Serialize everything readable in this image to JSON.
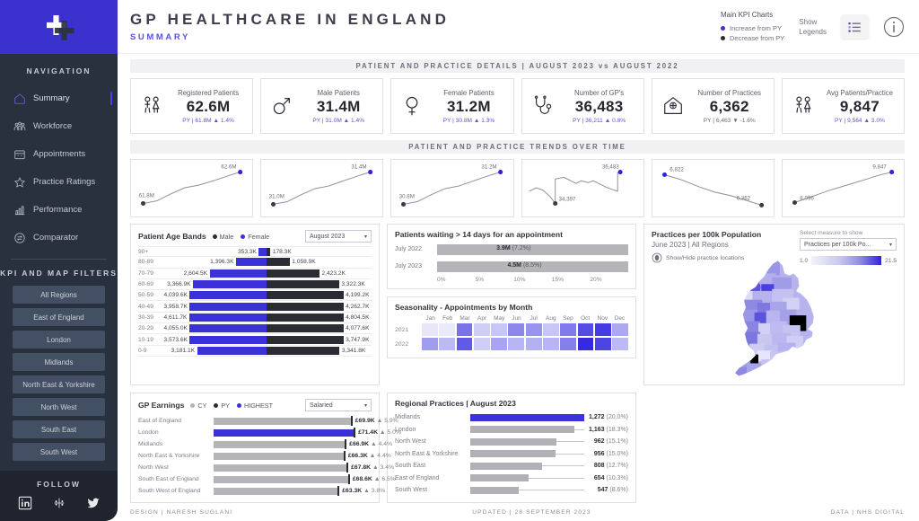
{
  "sidebar": {
    "logo_name": "nhs-cross-logo",
    "nav_heading": "NAVIGATION",
    "nav_items": [
      {
        "label": "Summary",
        "icon": "home-icon",
        "active": true
      },
      {
        "label": "Workforce",
        "icon": "people-icon",
        "active": false
      },
      {
        "label": "Appointments",
        "icon": "calendar-icon",
        "active": false
      },
      {
        "label": "Practice Ratings",
        "icon": "star-icon",
        "active": false
      },
      {
        "label": "Performance",
        "icon": "bar-chart-icon",
        "active": false
      },
      {
        "label": "Comparator",
        "icon": "compare-icon",
        "active": false
      }
    ],
    "filters_heading": "KPI AND MAP FILTERS",
    "filters": [
      {
        "label": "All Regions"
      },
      {
        "label": "East of England"
      },
      {
        "label": "London"
      },
      {
        "label": "Midlands"
      },
      {
        "label": "North East & Yorkshire"
      },
      {
        "label": "North West"
      },
      {
        "label": "South East"
      },
      {
        "label": "South West"
      }
    ],
    "follow_heading": "FOLLOW",
    "social": [
      {
        "name": "linkedin-icon"
      },
      {
        "name": "tableau-icon"
      },
      {
        "name": "twitter-icon"
      }
    ]
  },
  "header": {
    "title": "GP HEALTHCARE IN ENGLAND",
    "subtitle": "SUMMARY",
    "kpi_legend_title": "Main KPI Charts",
    "legend_increase": "Increase from PY",
    "legend_decrease": "Decrease from PY",
    "legend_increase_color": "#3a31d8",
    "legend_decrease_color": "#2b2b33",
    "show_legends_line1": "Show",
    "show_legends_line2": "Legends",
    "legend_button_icon": "list-legend-icon",
    "info_icon": "info-icon"
  },
  "bands": {
    "kpi": "PATIENT AND PRACTICE DETAILS | AUGUST 2023 vs AUGUST 2022",
    "trends": "PATIENT AND PRACTICE TRENDS OVER TIME"
  },
  "kpi_cards": [
    {
      "icon": "male-female-pair-icon",
      "label": "Registered Patients",
      "value": "62.6M",
      "py_prefix": "PY |",
      "py_value": "61.8M",
      "arrow": "▲",
      "delta": "1.4%",
      "up": true
    },
    {
      "icon": "male-symbol-icon",
      "label": "Male Patients",
      "value": "31.4M",
      "py_prefix": "PY |",
      "py_value": "31.0M",
      "arrow": "▲",
      "delta": "1.4%",
      "up": true
    },
    {
      "icon": "female-symbol-icon",
      "label": "Female Patients",
      "value": "31.2M",
      "py_prefix": "PY |",
      "py_value": "30.8M",
      "arrow": "▲",
      "delta": "1.3%",
      "up": true
    },
    {
      "icon": "stethoscope-icon",
      "label": "Number of GP's",
      "value": "36,483",
      "py_prefix": "PY |",
      "py_value": "36,211",
      "arrow": "▲",
      "delta": "0.8%",
      "up": true
    },
    {
      "icon": "clinic-house-icon",
      "label": "Number of Practices",
      "value": "6,362",
      "py_prefix": "PY |",
      "py_value": "6,463",
      "arrow": "▼",
      "delta": "-1.6%",
      "up": false
    },
    {
      "icon": "male-female-pair-icon",
      "label": "Avg Patients/Practice",
      "value": "9,847",
      "py_prefix": "PY |",
      "py_value": "9,564",
      "arrow": "▲",
      "delta": "3.0%",
      "up": true
    }
  ],
  "chart_data": [
    {
      "type": "line",
      "name": "registered-patients-trend",
      "title": "Registered Patients trend",
      "start_label": "61.8M",
      "end_label": "62.6M",
      "values": [
        0.1,
        0.14,
        0.32,
        0.48,
        0.55,
        0.72,
        0.88,
        1.0
      ],
      "grid": false,
      "legend": "none"
    },
    {
      "type": "line",
      "name": "male-patients-trend",
      "title": "Male Patients trend",
      "start_label": "31.0M",
      "end_label": "31.4M",
      "values": [
        0.08,
        0.12,
        0.3,
        0.47,
        0.54,
        0.7,
        0.87,
        1.0
      ],
      "grid": false,
      "legend": "none"
    },
    {
      "type": "line",
      "name": "female-patients-trend",
      "title": "Female Patients trend",
      "start_label": "30.8M",
      "end_label": "31.2M",
      "values": [
        0.08,
        0.13,
        0.31,
        0.48,
        0.55,
        0.71,
        0.88,
        1.0
      ],
      "grid": false,
      "legend": "none"
    },
    {
      "type": "line",
      "name": "number-of-gps-trend",
      "title": "Number of GP's trend",
      "start_label": "34,397",
      "end_label": "36,483",
      "values": [
        0.42,
        0.5,
        0.4,
        0.25,
        0.0,
        0.78,
        0.72,
        0.66,
        0.7,
        0.6,
        0.66,
        0.7,
        0.6,
        0.5,
        0.46,
        1.0
      ],
      "grid": false,
      "legend": "none"
    },
    {
      "type": "line",
      "name": "number-of-practices-trend",
      "title": "Number of Practices trend",
      "start_label": "6,822",
      "end_label": "6,362",
      "values": [
        1.0,
        0.86,
        0.72,
        0.6,
        0.5,
        0.42,
        0.36,
        0.3,
        0.22,
        0.12,
        0.05,
        0.0
      ],
      "grid": false,
      "legend": "none"
    },
    {
      "type": "line",
      "name": "avg-patients-per-practice-trend",
      "title": "Avg Patients/Practice trend",
      "start_label": "8,096",
      "end_label": "9,847",
      "values": [
        0.0,
        0.12,
        0.26,
        0.4,
        0.52,
        0.64,
        0.76,
        0.88,
        1.0
      ],
      "grid": false,
      "legend": "none"
    },
    {
      "type": "bar",
      "name": "patient-age-bands",
      "title": "Patient Age Bands",
      "subtitle": "August 2023",
      "orientation": "horizontal-diverging",
      "categories": [
        "90+",
        "80-89",
        "70-79",
        "60-69",
        "50-59",
        "40-49",
        "30-39",
        "20-29",
        "10-19",
        "0-9"
      ],
      "series": [
        {
          "name": "Female",
          "color": "#3a31d8",
          "side": "left",
          "labels": [
            "353.3K",
            "1,396.3K",
            "2,604.5K",
            "3,366.9K",
            "4,039.6K",
            "3,958.7K",
            "4,611.7K",
            "4,055.0K",
            "3,573.6K",
            "3,181.1K"
          ],
          "values": [
            353.3,
            1396.3,
            2604.5,
            3366.9,
            4039.6,
            3958.7,
            4611.7,
            4055.0,
            3573.6,
            3181.1
          ]
        },
        {
          "name": "Male",
          "color": "#2b2b33",
          "side": "right",
          "labels": [
            "178.3K",
            "1,058.9K",
            "2,423.2K",
            "3,322.3K",
            "4,199.2K",
            "4,262.7K",
            "4,804.5K",
            "4,077.6K",
            "3,747.9K",
            "3,341.8K"
          ],
          "values": [
            178.3,
            1058.9,
            2423.2,
            3322.3,
            4199.2,
            4262.7,
            4804.5,
            4077.6,
            3747.9,
            3341.8
          ]
        }
      ],
      "max_value": 4804.5,
      "xlabel": "",
      "ylabel": "Age band"
    },
    {
      "type": "bar",
      "name": "patients-waiting-over-14-days",
      "title": "Patients waiting  > 14 days for an appointment",
      "orientation": "horizontal",
      "categories": [
        "July 2022",
        "July 2023"
      ],
      "values": [
        7.2,
        8.5
      ],
      "value_labels": [
        "3.9M",
        "4.5M"
      ],
      "pct_labels": [
        "(7.2%)",
        "(8.5%)"
      ],
      "xlim": [
        0,
        22.5
      ],
      "xticks": [
        "0%",
        "5%",
        "10%",
        "15%",
        "20%"
      ],
      "bar_color": "#3a31d8",
      "track_color": "#b4b4b9",
      "grid": false
    },
    {
      "type": "heatmap",
      "name": "seasonality-appointments-by-month",
      "title": "Seasonality - Appointments by Month",
      "x": [
        "Jan",
        "Feb",
        "Mar",
        "Apr",
        "May",
        "Jun",
        "Jul",
        "Aug",
        "Sep",
        "Oct",
        "Nov",
        "Dec"
      ],
      "y": [
        "2021",
        "2022"
      ],
      "values": [
        [
          0.06,
          0.05,
          0.62,
          0.18,
          0.22,
          0.52,
          0.46,
          0.22,
          0.58,
          0.8,
          0.88,
          0.36
        ],
        [
          0.42,
          0.28,
          0.74,
          0.18,
          0.38,
          0.3,
          0.32,
          0.3,
          0.56,
          0.96,
          0.84,
          0.28
        ]
      ],
      "colorscale": [
        "#f4f4fc",
        "#2d22e0"
      ]
    },
    {
      "type": "bar",
      "name": "gp-earnings",
      "title": "GP Earnings",
      "subtitle": "Salaried",
      "orientation": "horizontal",
      "legend": [
        "CY",
        "PY",
        "HIGHEST"
      ],
      "legend_colors": [
        "#b4b4b9",
        "#2b2b33",
        "#3a31d8"
      ],
      "categories": [
        "East of England",
        "London",
        "Midlands",
        "North East & Yorkshire",
        "North West",
        "South East of England",
        "South West of England"
      ],
      "values": [
        69.9,
        71.4,
        66.9,
        66.3,
        67.8,
        68.6,
        63.3
      ],
      "value_labels": [
        "£69.9K",
        "£71.4K",
        "£66.9K",
        "£66.3K",
        "£67.8K",
        "£68.6K",
        "£63.3K"
      ],
      "delta_labels": [
        "5.9%",
        "5.0%",
        "4.4%",
        "4.4%",
        "3.4%",
        "6.5%",
        "3.8%"
      ],
      "arrow": "▲",
      "highest_index": 1
    },
    {
      "type": "bar",
      "name": "regional-practices",
      "title": "Regional Practices | August 2023",
      "orientation": "horizontal",
      "categories": [
        "Midlands",
        "London",
        "North West",
        "North East & Yorkshire",
        "South East",
        "East of England",
        "South West"
      ],
      "values": [
        1272,
        1163,
        962,
        956,
        808,
        654,
        547
      ],
      "value_labels": [
        "1,272",
        "1,163",
        "962",
        "956",
        "808",
        "654",
        "547"
      ],
      "pct_labels": [
        "(20.0%)",
        "(18.3%)",
        "(15.1%)",
        "(15.0%)",
        "(12.7%)",
        "(10.3%)",
        "(8.6%)"
      ],
      "highest_index": 0,
      "bar_color": "#b0b0b6",
      "highlight_color": "#3a31d8"
    },
    {
      "type": "heatmap",
      "name": "practices-per-100k-population-map",
      "title": "Practices per 100k Population",
      "subtitle": "June 2023 | All Regions",
      "legend_min": "1.0",
      "legend_max": "21.5",
      "colorscale": [
        "#f2f2fb",
        "#2d22e0"
      ],
      "geography": "England CCG / ICB areas"
    }
  ],
  "age_panel": {
    "title": "Patient Age Bands",
    "legend": [
      {
        "label": "Male",
        "color": "#2b2b33"
      },
      {
        "label": "Female",
        "color": "#3a31d8"
      }
    ],
    "select_value": "August 2023"
  },
  "waiting_panel": {
    "title": "Patients waiting  > 14 days for an appointment"
  },
  "season_panel": {
    "title": "Seasonality - Appointments by Month"
  },
  "earnings_panel": {
    "title": "GP Earnings",
    "legend": [
      {
        "label": "CY",
        "color": "#b4b4b9"
      },
      {
        "label": "PY",
        "color": "#2b2b33"
      },
      {
        "label": "HIGHEST",
        "color": "#3a31d8"
      }
    ],
    "select_value": "Salaried"
  },
  "regional_panel": {
    "title": "Regional Practices | August 2023"
  },
  "map_panel": {
    "title": "Practices per 100k Population",
    "subtitle": "June 2023 | All Regions",
    "toggle_label": "Show/Hide practice locations",
    "toggle_icon": "location-toggle-icon",
    "select_label": "Select measure to show",
    "select_value": "Practices per 100k Po...",
    "legend_min": "1.0",
    "legend_max": "21.5"
  },
  "footer": {
    "left": "DESIGN | NARESH SUGLANI",
    "center": "UPDATED | 28 SEPTEMBER 2023",
    "right": "DATA | NHS DIGITAL"
  }
}
